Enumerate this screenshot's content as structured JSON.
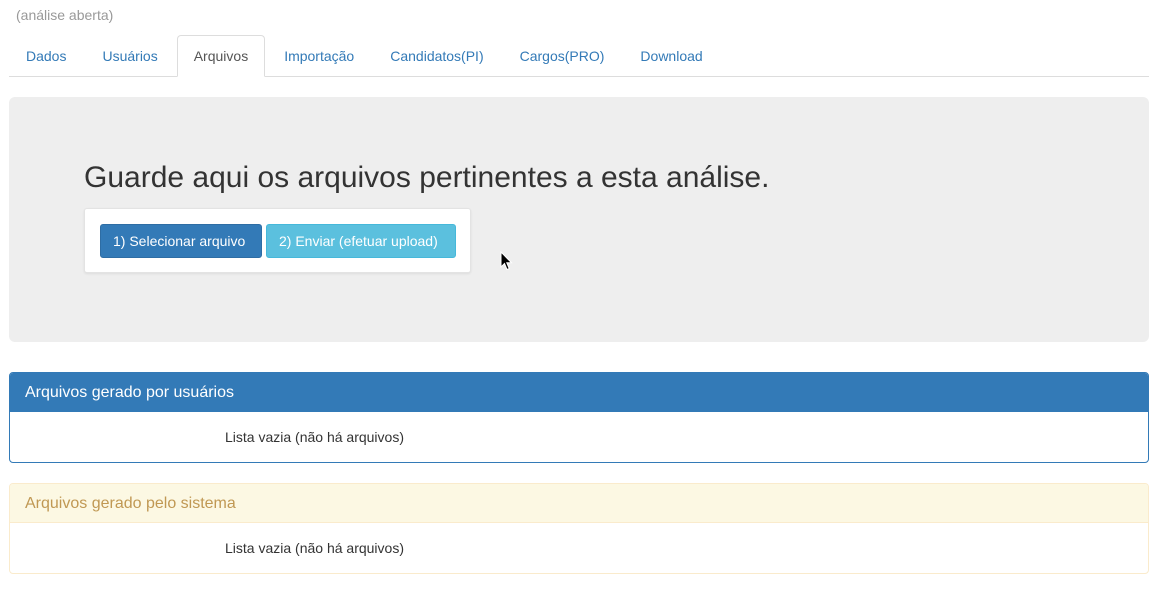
{
  "status_text": "(análise aberta)",
  "tabs": [
    {
      "label": "Dados"
    },
    {
      "label": "Usuários"
    },
    {
      "label": "Arquivos"
    },
    {
      "label": "Importação"
    },
    {
      "label": "Candidatos(PI)"
    },
    {
      "label": "Cargos(PRO)"
    },
    {
      "label": "Download"
    }
  ],
  "active_tab": "Arquivos",
  "upload": {
    "heading": "Guarde aqui os arquivos pertinentes a esta análise.",
    "select_button": "1) Selecionar arquivo",
    "send_button": "2) Enviar (efetuar upload)"
  },
  "panels": {
    "user_files": {
      "title": "Arquivos gerado por usuários",
      "empty_text": "Lista vazia (não há arquivos)"
    },
    "system_files": {
      "title": "Arquivos gerado pelo sistema",
      "empty_text": "Lista vazia (não há arquivos)"
    }
  },
  "colors": {
    "primary": "#337ab7",
    "info": "#5bc0de",
    "warning_bg": "#fcf8e3",
    "warning_text": "#c09853",
    "jumbotron_bg": "#eeeeee"
  }
}
